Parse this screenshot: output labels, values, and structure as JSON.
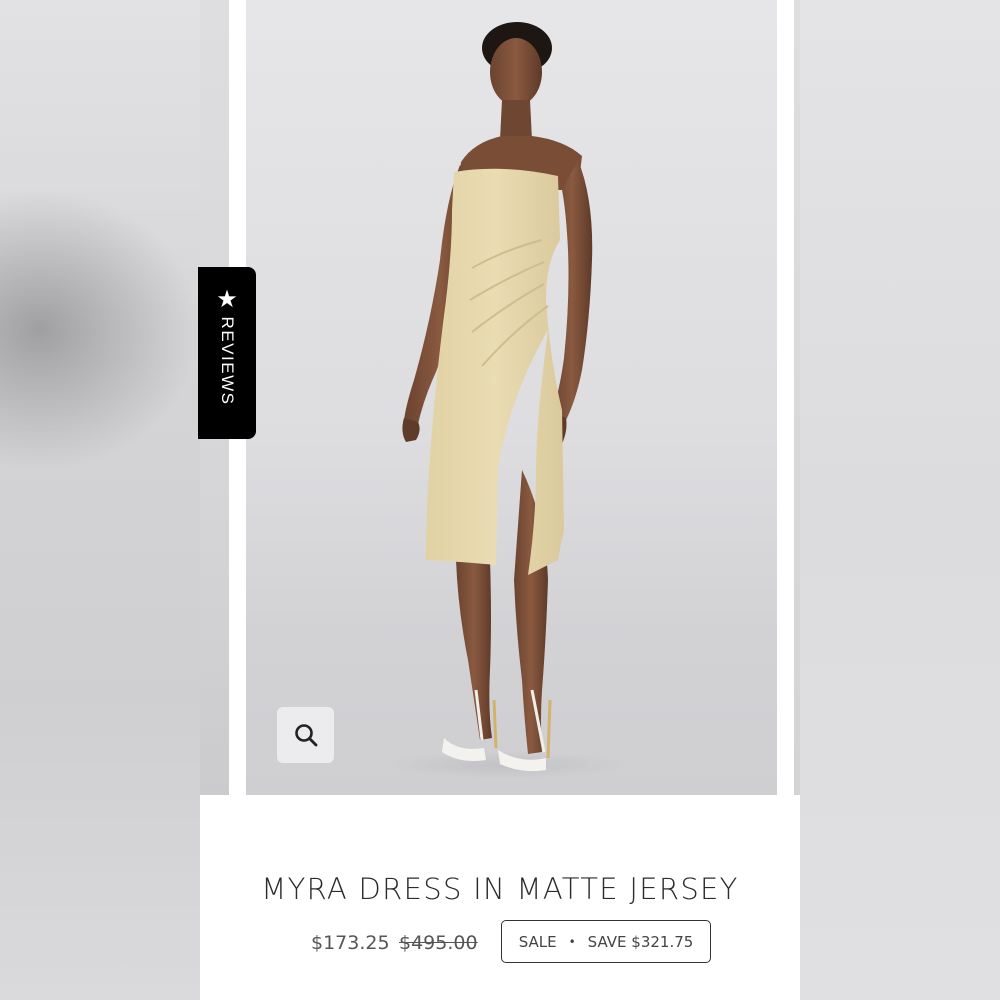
{
  "reviews_tab": {
    "icon": "star-icon",
    "label": "REVIEWS"
  },
  "zoom": {
    "icon": "search-icon"
  },
  "product": {
    "title": "MYRA DRESS IN MATTE JERSEY",
    "price_current": "$173.25",
    "price_original": "$495.00",
    "badge_sale": "SALE",
    "badge_separator": "•",
    "badge_save": "SAVE $321.75"
  },
  "colors": {
    "dress": "#e6d8ae",
    "tab_background": "#000000",
    "badge_border": "#333333"
  }
}
